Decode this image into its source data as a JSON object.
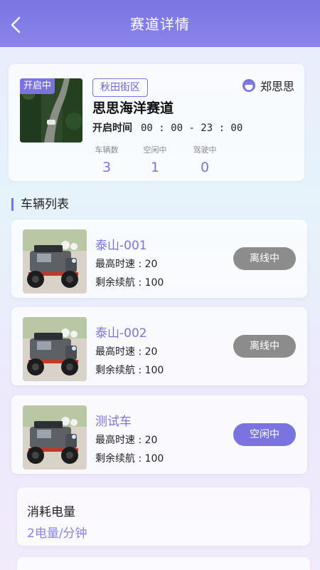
{
  "header": {
    "title": "赛道详情"
  },
  "track": {
    "status_tag": "开启中",
    "district": "秋田街区",
    "owner": "郑思思",
    "name": "思思海洋赛道",
    "open_time_label": "开启时间",
    "open_time_value": "00 : 00 - 23 : 00",
    "stats": [
      {
        "label": "车辆数",
        "value": "3"
      },
      {
        "label": "空闲中",
        "value": "1"
      },
      {
        "label": "驾驶中",
        "value": "0"
      }
    ]
  },
  "vehicle_list": {
    "title": "车辆列表",
    "items": [
      {
        "name": "泰山-001",
        "max_speed": "最高时速 : 20",
        "range": "剩余续航 : 100",
        "status": "离线中"
      },
      {
        "name": "泰山-002",
        "max_speed": "最高时速 : 20",
        "range": "剩余续航 : 100",
        "status": "离线中"
      },
      {
        "name": "测试车",
        "max_speed": "最高时速 : 20",
        "range": "剩余续航 : 100",
        "status": "空闲中"
      }
    ]
  },
  "power": {
    "title": "消耗电量",
    "value": "2电量/分钟"
  },
  "colors": {
    "accent": "#7b73e0",
    "offline": "#8c8c8c",
    "header": "#7a74e3"
  },
  "icons": {
    "back": "chevron-left-icon",
    "owner": "user-avatar-icon"
  }
}
